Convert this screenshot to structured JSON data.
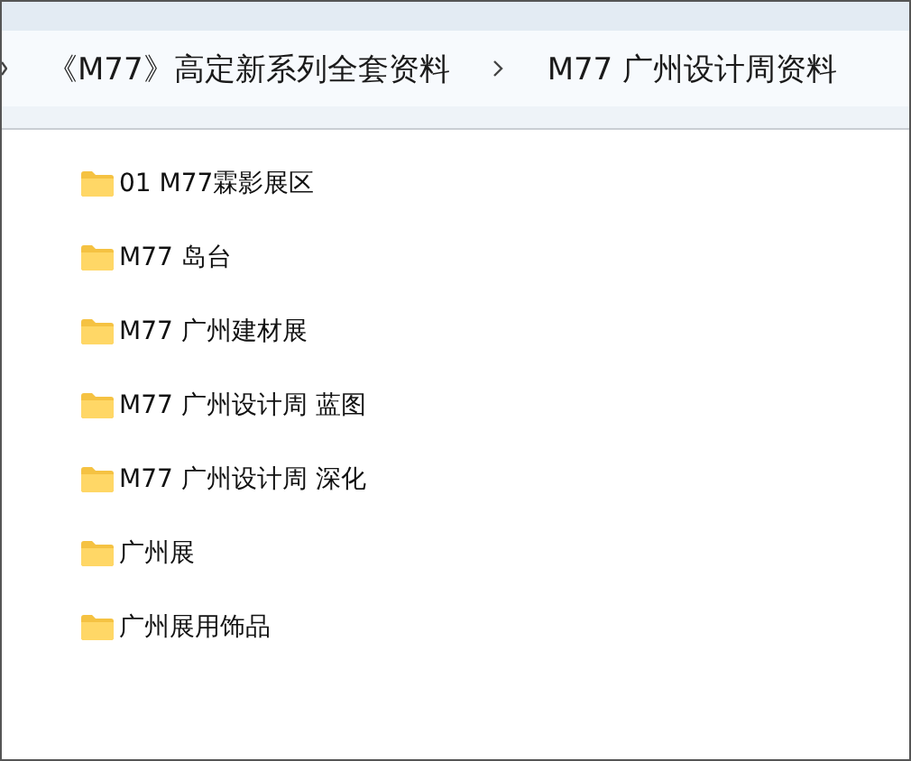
{
  "breadcrumb": [
    {
      "label": "《M77》高定新系列全套资料"
    },
    {
      "label": "M77  广州设计周资料"
    }
  ],
  "items": [
    {
      "name": "01 M77霖影展区"
    },
    {
      "name": "M77 岛台"
    },
    {
      "name": "M77 广州建材展"
    },
    {
      "name": "M77 广州设计周  蓝图"
    },
    {
      "name": "M77 广州设计周  深化"
    },
    {
      "name": "广州展"
    },
    {
      "name": "广州展用饰品"
    }
  ]
}
